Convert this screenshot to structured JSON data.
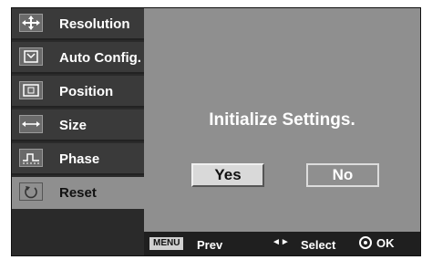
{
  "menu": {
    "items": [
      {
        "label": "Resolution",
        "icon": "resolution-icon"
      },
      {
        "label": "Auto Config.",
        "icon": "auto-config-icon"
      },
      {
        "label": "Position",
        "icon": "position-icon"
      },
      {
        "label": "Size",
        "icon": "size-icon"
      },
      {
        "label": "Phase",
        "icon": "phase-icon"
      },
      {
        "label": "Reset",
        "icon": "reset-icon"
      }
    ],
    "selected_index": 5
  },
  "dialog": {
    "title": "Initialize Settings.",
    "yes_label": "Yes",
    "no_label": "No"
  },
  "footer": {
    "menu_key": "MENU",
    "prev_label": "Prev",
    "select_arrows": "◄►",
    "select_label": "Select",
    "ok_label": "OK"
  },
  "colors": {
    "osd_background": "#1f1f1f",
    "menu_item": "#3a3a3a",
    "pane": "#8f8f8f",
    "text": "#ffffff"
  }
}
